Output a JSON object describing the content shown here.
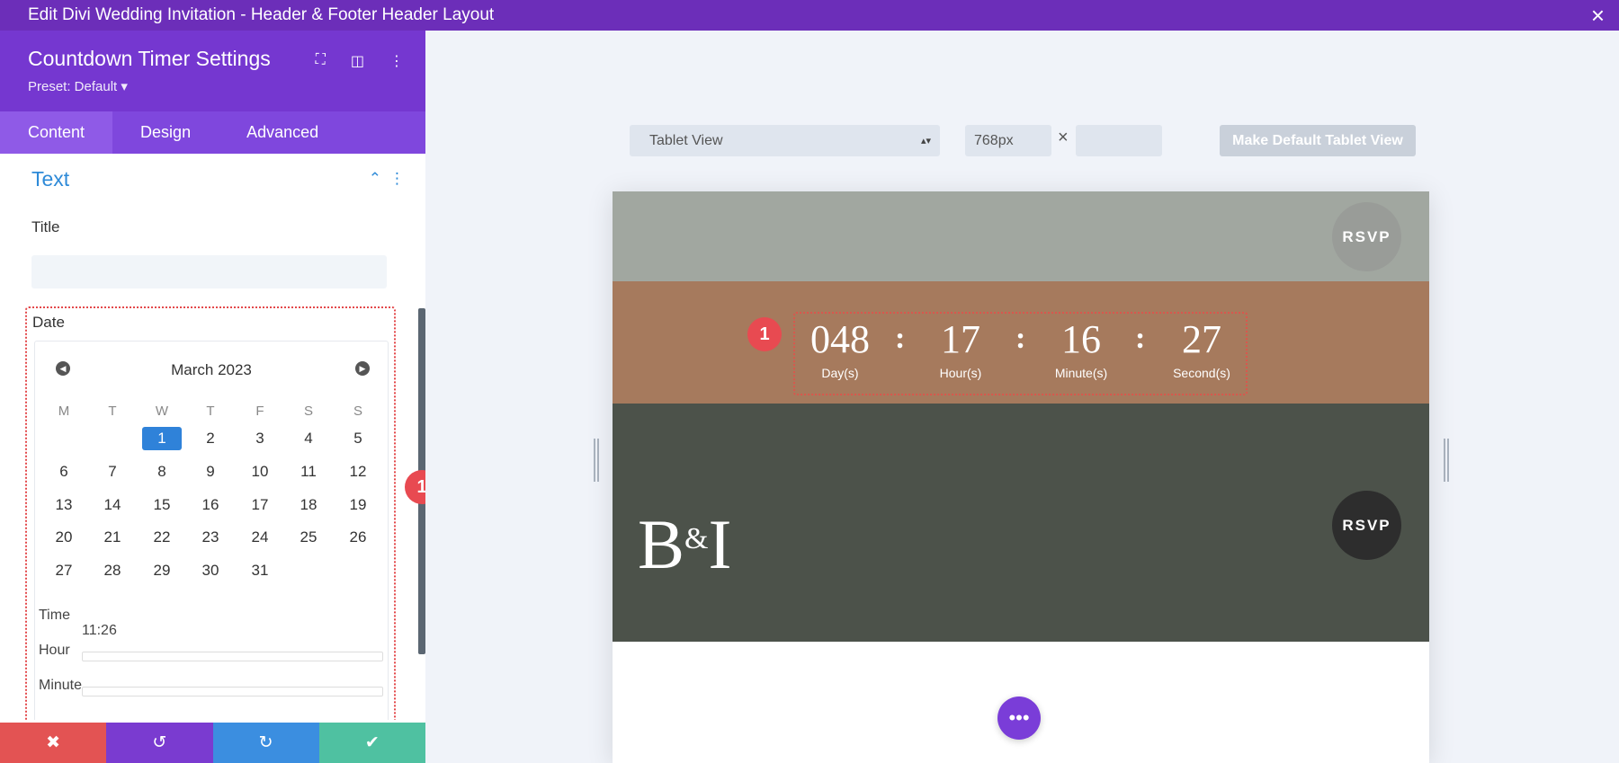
{
  "topbar": {
    "title": "Edit Divi Wedding Invitation - Header & Footer Header Layout",
    "close_icon": "×"
  },
  "panel": {
    "title": "Countdown Timer Settings",
    "preset": "Preset: Default ▾",
    "header_icons": [
      "⛶",
      "◫",
      "⋮"
    ],
    "tabs": [
      "Content",
      "Design",
      "Advanced"
    ],
    "section": {
      "title": "Text",
      "chevron": "⌃",
      "menu": "⋮"
    },
    "title_label": "Title",
    "date_label": "Date",
    "calendar": {
      "month": "March 2023",
      "prev": "◀",
      "next": "▶",
      "weekdays": [
        "M",
        "T",
        "W",
        "T",
        "F",
        "S",
        "S"
      ],
      "selected_day": "1",
      "time_label": "Time",
      "time_value": "11:26",
      "hour_label": "Hour",
      "minute_label": "Minute"
    },
    "badge": "1",
    "actions": [
      "✖",
      "↺",
      "↻",
      "✔"
    ]
  },
  "canvas": {
    "view_select": "Tablet View",
    "view_select_arrow": "▴▾",
    "width_value": "768px",
    "times": "×",
    "make_default": "Make Default Tablet View",
    "rsvp_top": "RSVP",
    "rsvp_bottom": "RSVP",
    "badge": "1",
    "countdown": [
      {
        "value": "048",
        "label": "Day(s)"
      },
      {
        "value": "17",
        "label": "Hour(s)"
      },
      {
        "value": "16",
        "label": "Minute(s)"
      },
      {
        "value": "27",
        "label": "Second(s)"
      }
    ],
    "separator": ":",
    "logo_left": "B",
    "logo_amp": "&",
    "logo_right": "I",
    "fab": "•••"
  },
  "colors": {
    "topbar": "#6c2eb9",
    "panel_header": "#7537d0",
    "tabs": "#7f47dd",
    "accent_blue": "#2e8ad8",
    "action_cancel": "#e35353",
    "action_undo": "#7a3bd0",
    "action_redo": "#3b8ee0",
    "action_save": "#4fc1a1"
  }
}
